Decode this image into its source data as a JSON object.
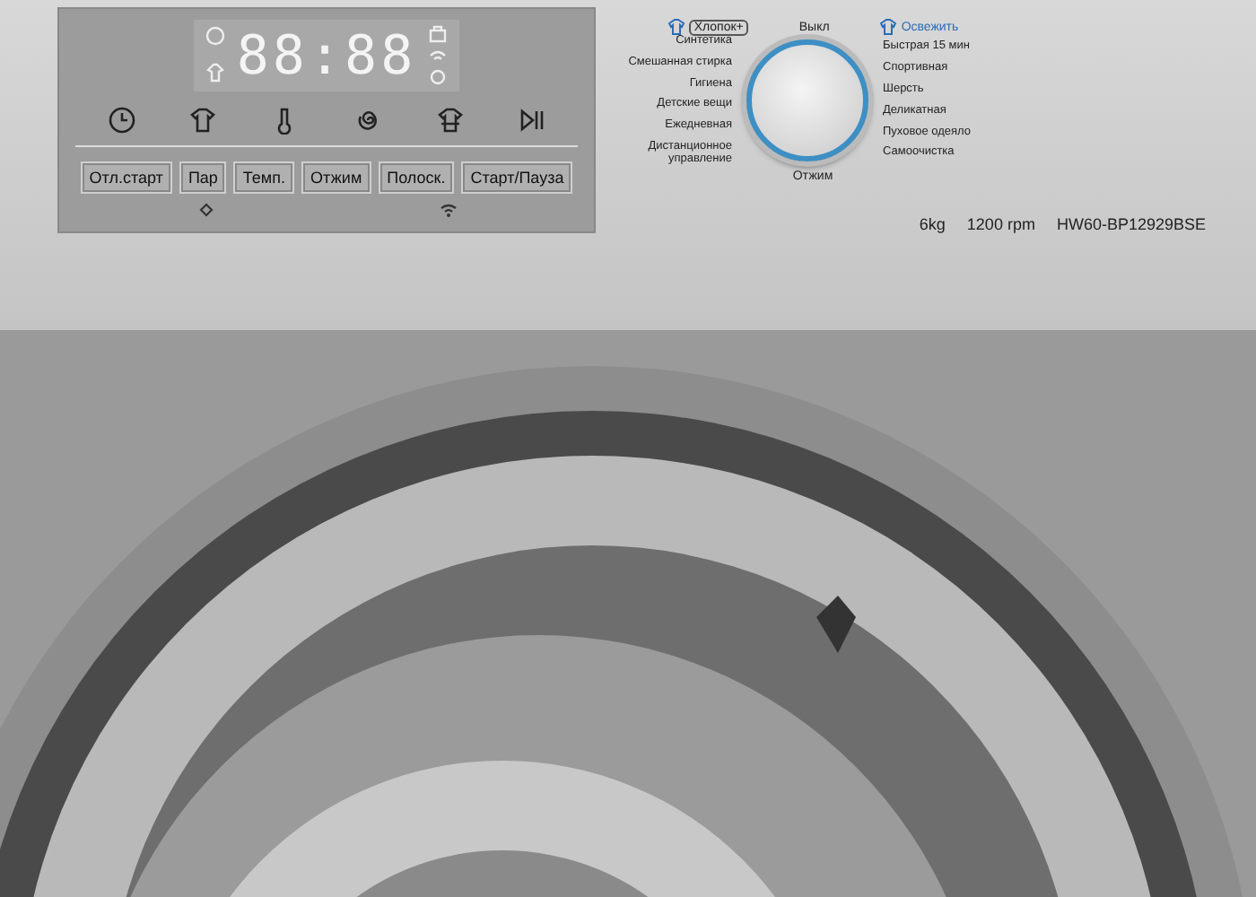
{
  "display": {
    "digits": "88:88"
  },
  "buttons": [
    "Отл.старт",
    "Пар",
    "Темп.",
    "Отжим",
    "Полоск.",
    "Старт/Пауза"
  ],
  "dial": {
    "top": [
      {
        "label": "Хлопок+",
        "kind": "framed"
      },
      {
        "label": "Выкл",
        "kind": "plain"
      },
      {
        "label": "Освежить",
        "kind": "accent"
      }
    ],
    "left": [
      "Синтетика",
      "Смешанная стирка",
      "Гигиена",
      "Детские вещи",
      "Ежедневная",
      "Дистанционное управление"
    ],
    "right": [
      "Быстрая 15 мин",
      "Спортивная",
      "Шерсть",
      "Деликатная",
      "Пуховое одеяло",
      "Самоочистка"
    ],
    "bottom": "Отжим"
  },
  "specs": [
    "6kg",
    "1200 rpm",
    "HW60-BP12929BSE"
  ]
}
